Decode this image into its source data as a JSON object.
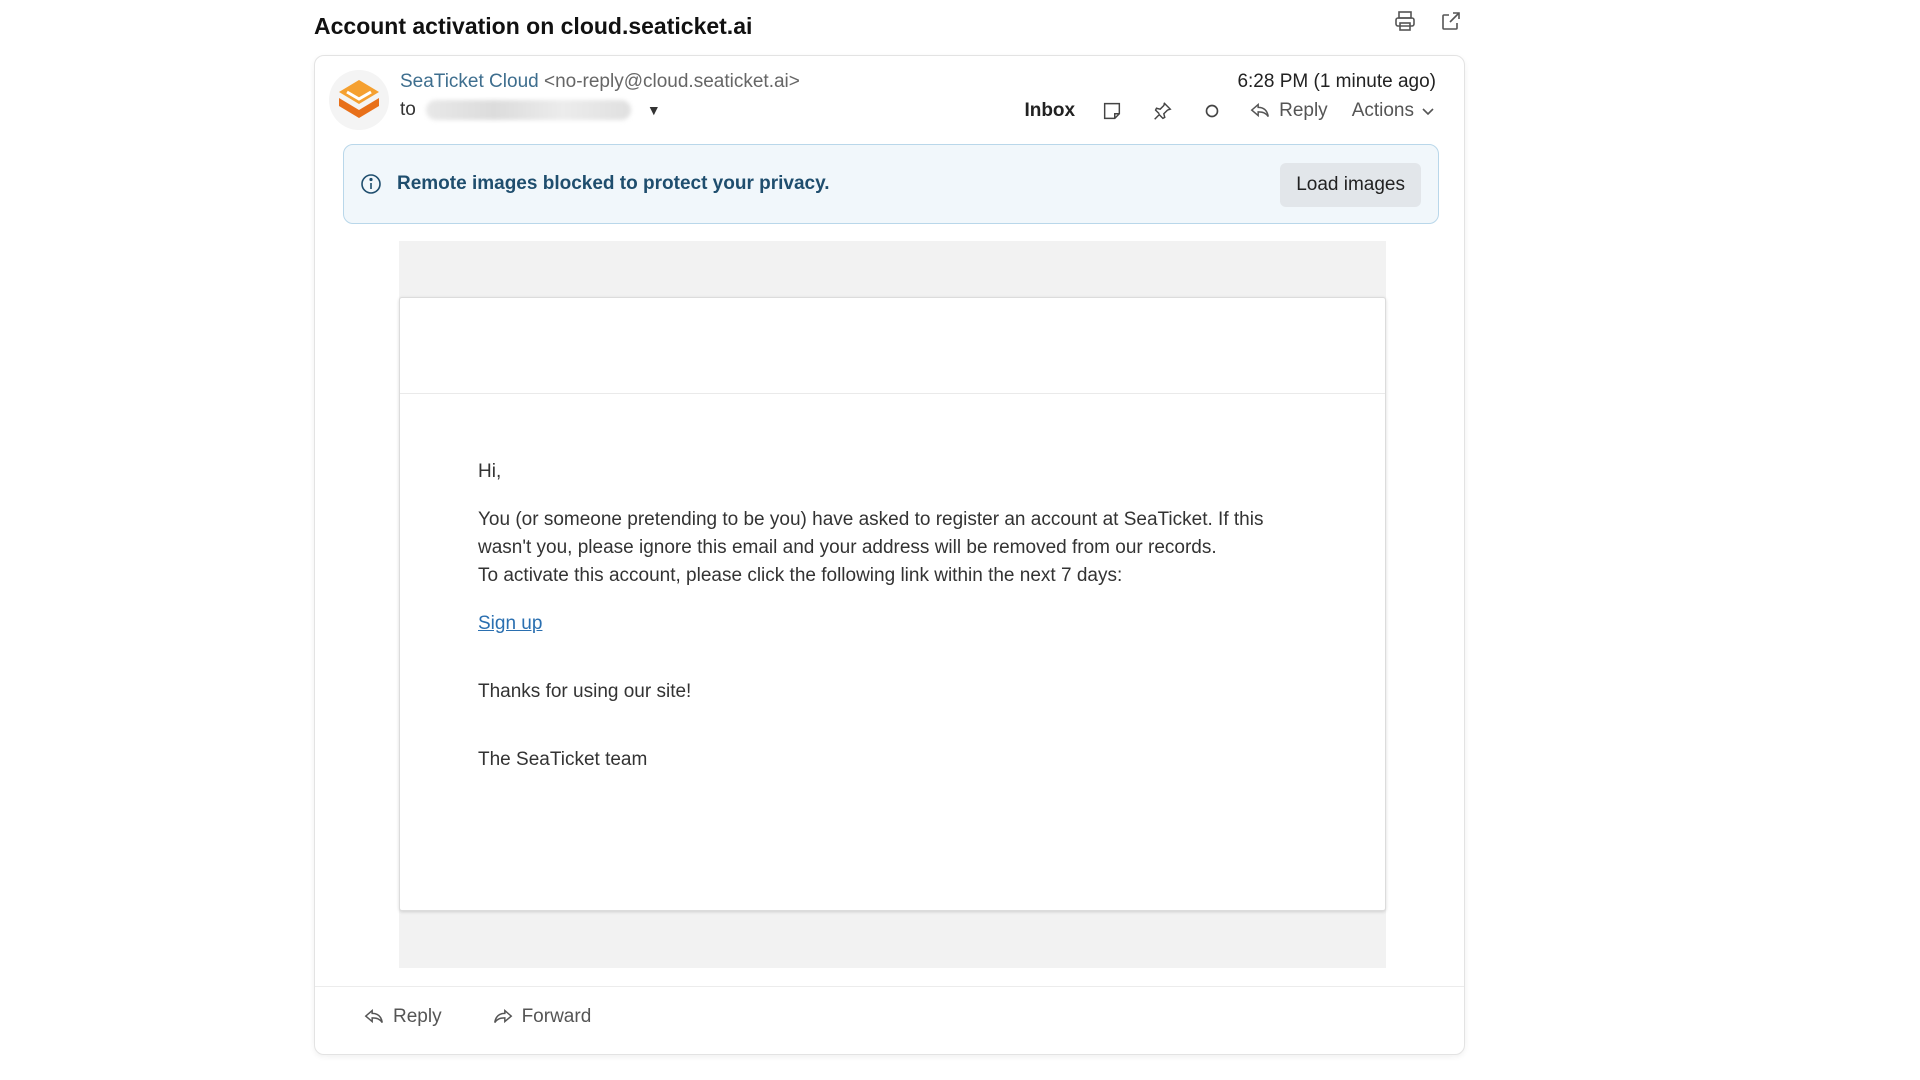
{
  "subject": "Account activation on cloud.seaticket.ai",
  "top_icons": [
    "printer-icon",
    "open-external-icon"
  ],
  "sender": {
    "name": "SeaTicket Cloud",
    "email": "<no-reply@cloud.seaticket.ai>",
    "to_label": "to"
  },
  "date": "6:28 PM (1 minute ago)",
  "actions": {
    "folder": "Inbox",
    "reply": "Reply",
    "menu": "Actions"
  },
  "privacy": {
    "message": "Remote images blocked to protect your privacy.",
    "button": "Load images"
  },
  "body": {
    "greeting": "Hi,",
    "paragraph1": "You (or someone pretending to be you) have asked to register an account at SeaTicket. If this wasn't you, please ignore this email and your address will be removed from our records.",
    "paragraph2": "To activate this account, please click the following link within the next 7 days:",
    "link": "Sign up",
    "thanks": "Thanks for using our site!",
    "signature": "The SeaTicket team"
  },
  "footer": {
    "reply": "Reply",
    "forward": "Forward"
  },
  "colors": {
    "brand_orange": "#f07d1a",
    "link_blue": "#2a6fb0",
    "info_bg": "#f1f7fb"
  }
}
